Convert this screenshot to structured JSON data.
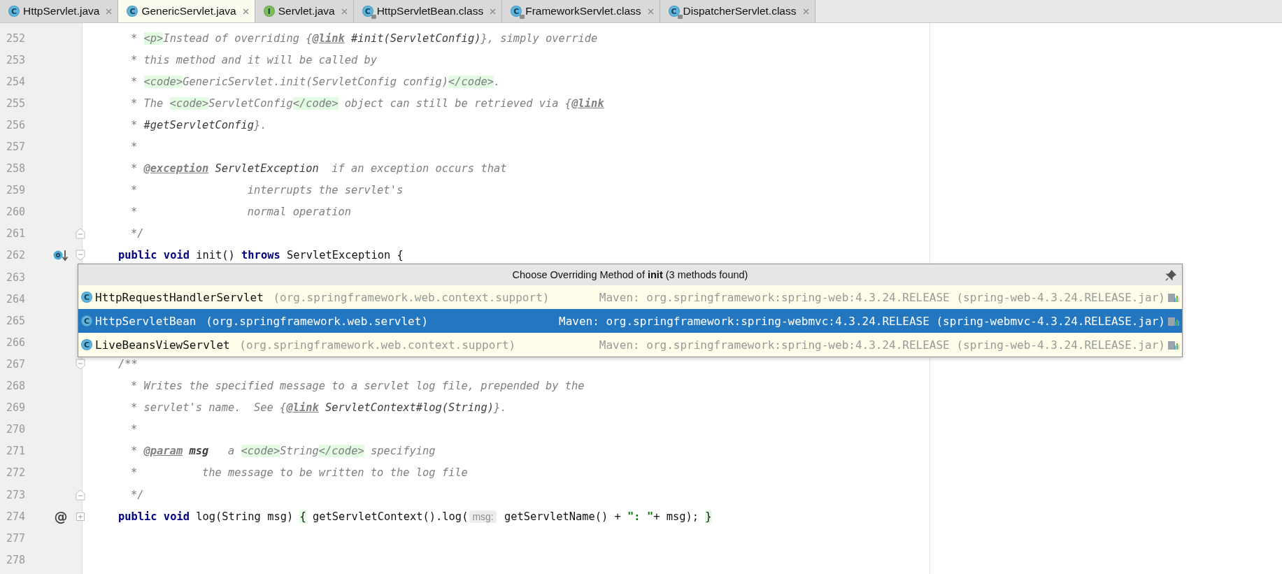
{
  "tabs": [
    {
      "label": "HttpServlet.java",
      "kind": "class",
      "icon_letter": "C",
      "locked": false,
      "selected": false
    },
    {
      "label": "GenericServlet.java",
      "kind": "class",
      "icon_letter": "C",
      "locked": false,
      "selected": true
    },
    {
      "label": "Servlet.java",
      "kind": "interface",
      "icon_letter": "I",
      "locked": false,
      "selected": false
    },
    {
      "label": "HttpServletBean.class",
      "kind": "class",
      "icon_letter": "C",
      "locked": true,
      "selected": false
    },
    {
      "label": "FrameworkServlet.class",
      "kind": "class",
      "icon_letter": "C",
      "locked": true,
      "selected": false
    },
    {
      "label": "DispatcherServlet.class",
      "kind": "class",
      "icon_letter": "C",
      "locked": true,
      "selected": false
    }
  ],
  "editor": {
    "lines": [
      {
        "number": "252",
        "kind": "doc",
        "tokens": [
          {
            "kind": "comment",
            "text": "* "
          },
          {
            "kind": "html",
            "text": "<p>"
          },
          {
            "kind": "comment",
            "text": "Instead of overriding {"
          },
          {
            "kind": "tag",
            "text": "@link"
          },
          {
            "kind": "ref",
            "text": " #init(ServletConfig)"
          },
          {
            "kind": "comment",
            "text": "}, simply override"
          }
        ]
      },
      {
        "number": "253",
        "kind": "doc",
        "tokens": [
          {
            "kind": "comment",
            "text": "* this method and it will be called by"
          }
        ]
      },
      {
        "number": "254",
        "kind": "doc",
        "tokens": [
          {
            "kind": "comment",
            "text": "* "
          },
          {
            "kind": "html",
            "text": "<code>"
          },
          {
            "kind": "comment",
            "text": "GenericServlet.init(ServletConfig config)"
          },
          {
            "kind": "html",
            "text": "</code>"
          },
          {
            "kind": "comment",
            "text": "."
          }
        ]
      },
      {
        "number": "255",
        "kind": "doc",
        "tokens": [
          {
            "kind": "comment",
            "text": "* The "
          },
          {
            "kind": "html",
            "text": "<code>"
          },
          {
            "kind": "comment",
            "text": "ServletConfig"
          },
          {
            "kind": "html",
            "text": "</code>"
          },
          {
            "kind": "comment",
            "text": " object can still be retrieved via {"
          },
          {
            "kind": "tag",
            "text": "@link"
          }
        ]
      },
      {
        "number": "256",
        "kind": "doc",
        "tokens": [
          {
            "kind": "comment",
            "text": "* "
          },
          {
            "kind": "ref",
            "text": "#getServletConfig"
          },
          {
            "kind": "comment",
            "text": "}."
          }
        ]
      },
      {
        "number": "257",
        "kind": "doc",
        "tokens": [
          {
            "kind": "comment",
            "text": "*"
          }
        ]
      },
      {
        "number": "258",
        "kind": "doc",
        "tokens": [
          {
            "kind": "comment",
            "text": "* "
          },
          {
            "kind": "tag",
            "text": "@exception"
          },
          {
            "kind": "ref",
            "text": " ServletException"
          },
          {
            "kind": "comment",
            "text": "  if an exception occurs that"
          }
        ]
      },
      {
        "number": "259",
        "kind": "doc",
        "tokens": [
          {
            "kind": "comment",
            "text": "*                 interrupts the servlet's"
          }
        ]
      },
      {
        "number": "260",
        "kind": "doc",
        "tokens": [
          {
            "kind": "comment",
            "text": "*                 normal operation"
          }
        ]
      },
      {
        "number": "261",
        "kind": "doc",
        "fold_end": true,
        "tokens": [
          {
            "kind": "comment",
            "text": "*/"
          }
        ]
      },
      {
        "number": "262",
        "kind": "code",
        "fold_start": true,
        "overridden": true,
        "tokens": [
          {
            "kind": "keyword",
            "text": "public void"
          },
          {
            "kind": "plain",
            "text": " init() "
          },
          {
            "kind": "keyword",
            "text": "throws"
          },
          {
            "kind": "plain",
            "text": " ServletException {"
          }
        ]
      },
      {
        "number": "263",
        "kind": "code"
      },
      {
        "number": "264",
        "kind": "code"
      },
      {
        "number": "265",
        "kind": "code"
      },
      {
        "number": "266",
        "kind": "code"
      },
      {
        "number": "267",
        "kind": "code",
        "fold_start": true,
        "tokens": [
          {
            "kind": "comment",
            "text": "/**"
          }
        ]
      },
      {
        "number": "268",
        "kind": "doc",
        "tokens": [
          {
            "kind": "comment",
            "text": "* Writes the specified message to a servlet log file, prepended by the"
          }
        ]
      },
      {
        "number": "269",
        "kind": "doc",
        "tokens": [
          {
            "kind": "comment",
            "text": "* servlet's name.  See {"
          },
          {
            "kind": "tag",
            "text": "@link"
          },
          {
            "kind": "ref",
            "text": " ServletContext#log(String)"
          },
          {
            "kind": "comment",
            "text": "}."
          }
        ]
      },
      {
        "number": "270",
        "kind": "doc",
        "tokens": [
          {
            "kind": "comment",
            "text": "*"
          }
        ]
      },
      {
        "number": "271",
        "kind": "doc",
        "tokens": [
          {
            "kind": "comment",
            "text": "* "
          },
          {
            "kind": "tag",
            "text": "@param"
          },
          {
            "kind": "ref_bold",
            "text": " msg"
          },
          {
            "kind": "comment",
            "text": "   a "
          },
          {
            "kind": "html",
            "text": "<code>"
          },
          {
            "kind": "comment",
            "text": "String"
          },
          {
            "kind": "html",
            "text": "</code>"
          },
          {
            "kind": "comment",
            "text": " specifying"
          }
        ]
      },
      {
        "number": "272",
        "kind": "doc",
        "tokens": [
          {
            "kind": "comment",
            "text": "*          the message to be written to the log file"
          }
        ]
      },
      {
        "number": "273",
        "kind": "doc",
        "fold_end": true,
        "tokens": [
          {
            "kind": "comment",
            "text": "*/"
          }
        ]
      },
      {
        "number": "274",
        "kind": "code",
        "folded": true,
        "gutter_text": "@",
        "tokens": [
          {
            "kind": "keyword",
            "text": "public void"
          },
          {
            "kind": "plain",
            "text": " log(String msg) "
          },
          {
            "kind": "brace",
            "text": "{"
          },
          {
            "kind": "plain",
            "text": " getServletContext().log("
          },
          {
            "kind": "hint",
            "text": "msg:"
          },
          {
            "kind": "plain",
            "text": " getServletName() + "
          },
          {
            "kind": "string",
            "text": "\": \""
          },
          {
            "kind": "plain",
            "text": "+ msg); "
          },
          {
            "kind": "brace",
            "text": "}"
          }
        ]
      },
      {
        "number": "277",
        "kind": "code"
      },
      {
        "number": "278",
        "kind": "code"
      }
    ]
  },
  "popup": {
    "title": "Choose Overriding Method of **init** (3 methods found)",
    "items": [
      {
        "icon_letter": "C",
        "name": "HttpRequestHandlerServlet",
        "package": "(org.springframework.web.context.support)",
        "location": "Maven: org.springframework:spring-web:4.3.24.RELEASE (spring-web-4.3.24.RELEASE.jar)",
        "selected": false
      },
      {
        "icon_letter": "C",
        "name": "HttpServletBean",
        "package": "(org.springframework.web.servlet)",
        "location": "Maven: org.springframework:spring-webmvc:4.3.24.RELEASE (spring-webmvc-4.3.24.RELEASE.jar)",
        "selected": true
      },
      {
        "icon_letter": "C",
        "name": "LiveBeansViewServlet",
        "package": "(org.springframework.web.context.support)",
        "location": "Maven: org.springframework:spring-web:4.3.24.RELEASE (spring-web-4.3.24.RELEASE.jar)",
        "selected": false
      }
    ]
  }
}
